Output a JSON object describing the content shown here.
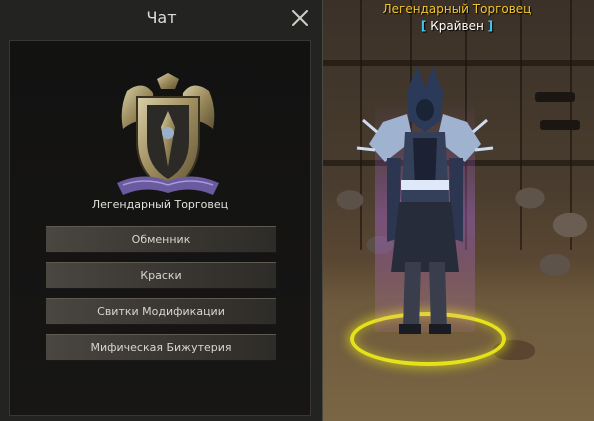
{
  "chat_window": {
    "title": "Чат",
    "close_icon": "close-icon",
    "emblem_icon": "guild-crest-icon",
    "npc_label": "Легендарный Торговец",
    "menu": [
      {
        "label": "Обменник"
      },
      {
        "label": "Краски"
      },
      {
        "label": "Свитки Модификации"
      },
      {
        "label": "Мифическая Бижутерия"
      }
    ]
  },
  "npc": {
    "title": "Легендарный Торговец",
    "name": "Крайвен",
    "bracket_open": "[",
    "bracket_close": "]",
    "title_color": "#f2c530",
    "bracket_color": "#42c7f0",
    "target_ring_color": "#e6e21a"
  }
}
